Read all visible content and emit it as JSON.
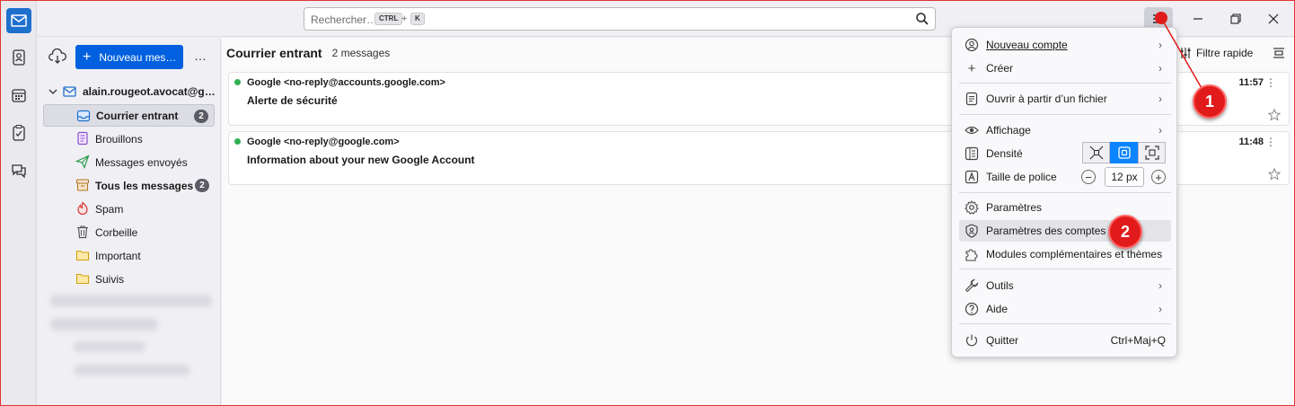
{
  "search": {
    "placeholder": "Rechercher…",
    "kbd1": "CTRL",
    "plus": "+",
    "kbd2": "K"
  },
  "toolbar": {
    "new_message": "Nouveau mes…",
    "more": "…"
  },
  "account": {
    "name": "alain.rougeot.avocat@g…"
  },
  "folders": [
    {
      "label": "Courrier entrant",
      "badge": "2",
      "icon": "inbox-icon"
    },
    {
      "label": "Brouillons",
      "icon": "drafts-icon"
    },
    {
      "label": "Messages envoyés",
      "icon": "sent-icon"
    },
    {
      "label": "Tous les messages",
      "badge": "2",
      "icon": "archive-icon"
    },
    {
      "label": "Spam",
      "icon": "spam-icon"
    },
    {
      "label": "Corbeille",
      "icon": "trash-icon"
    },
    {
      "label": "Important",
      "icon": "folder-icon"
    },
    {
      "label": "Suivis",
      "icon": "folder-icon"
    }
  ],
  "message_list": {
    "title": "Courrier entrant",
    "count": "2 messages",
    "quick_filter": "Filtre rapide",
    "messages": [
      {
        "from": "Google <no-reply@accounts.google.com>",
        "subject": "Alerte de sécurité",
        "time": "11:57"
      },
      {
        "from": "Google <no-reply@google.com>",
        "subject": "Information about your new Google Account",
        "time": "11:48"
      }
    ]
  },
  "app_menu": {
    "items": {
      "new_account": "Nouveau compte",
      "create": "Créer",
      "open_file": "Ouvrir à partir d’un fichier",
      "view": "Affichage",
      "density": "Densité",
      "font_size": "Taille de police",
      "font_size_value": "12 px",
      "settings": "Paramètres",
      "account_settings": "Paramètres des comptes",
      "addons": "Modules complémentaires et thèmes",
      "tools": "Outils",
      "help": "Aide",
      "quit": "Quitter",
      "quit_shortcut": "Ctrl+Maj+Q"
    }
  },
  "annotations": {
    "step1": "1",
    "step2": "2",
    "color": "#e11b1b"
  },
  "colors": {
    "accent": "#0060df",
    "density_active": "#0a84ff",
    "unread_dot": "#30b050"
  }
}
